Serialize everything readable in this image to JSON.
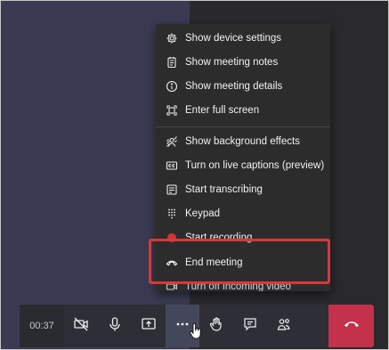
{
  "menu": {
    "items": [
      {
        "label": "Show device settings",
        "icon": "gear-icon"
      },
      {
        "label": "Show meeting notes",
        "icon": "notes-icon"
      },
      {
        "label": "Show meeting details",
        "icon": "info-icon"
      },
      {
        "label": "Enter full screen",
        "icon": "fullscreen-icon"
      },
      {
        "label": "Show background effects",
        "icon": "background-effects-icon"
      },
      {
        "label": "Turn on live captions (preview)",
        "icon": "captions-icon"
      },
      {
        "label": "Start transcribing",
        "icon": "transcript-icon"
      },
      {
        "label": "Keypad",
        "icon": "keypad-icon"
      },
      {
        "label": "Start recording",
        "icon": "record-icon"
      },
      {
        "label": "End meeting",
        "icon": "end-meeting-icon"
      },
      {
        "label": "Turn off incoming video",
        "icon": "video-off-icon"
      }
    ]
  },
  "toolbar": {
    "timer": "00:37",
    "buttons": [
      {
        "name": "camera-toggle-button",
        "icon": "video-off-icon"
      },
      {
        "name": "microphone-button",
        "icon": "microphone-icon"
      },
      {
        "name": "share-screen-button",
        "icon": "share-icon"
      },
      {
        "name": "more-actions-button",
        "icon": "ellipsis-icon"
      },
      {
        "name": "raise-hand-button",
        "icon": "hand-icon"
      },
      {
        "name": "chat-button",
        "icon": "chat-icon"
      },
      {
        "name": "participants-button",
        "icon": "people-icon"
      }
    ],
    "hangup_icon": "hang-up-icon"
  },
  "colors": {
    "menu_bg": "#2d2c2c",
    "highlight": "#d9383a",
    "hangup": "#c4314b",
    "active_button": "#44475a"
  }
}
